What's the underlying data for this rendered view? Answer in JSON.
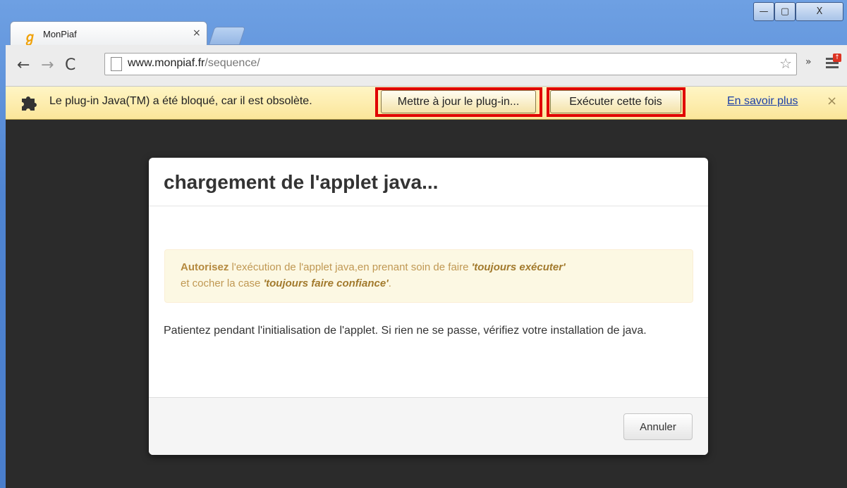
{
  "tab": {
    "title": "MonPiaf",
    "close": "×"
  },
  "window_controls": {
    "minimize": "—",
    "maximize": "▢",
    "close": "X"
  },
  "address": {
    "domain": "www.monpiaf.fr",
    "path": "/sequence/"
  },
  "infobar": {
    "message": "Le plug-in Java(TM) a été bloqué, car il est obsolète.",
    "update_button": "Mettre à jour le plug-in...",
    "run_button": "Exécuter cette fois",
    "learn_more": "En savoir plus",
    "close": "×"
  },
  "dialog": {
    "title": "chargement de l'applet java...",
    "alert": {
      "strong": "Autorisez",
      "text1": " l'exécution de l'applet java,en prenant soin de faire ",
      "em1": "'toujours exécuter'",
      "text2": "et cocher la case ",
      "em2": "'toujours faire confiance'",
      "text3": "."
    },
    "body": "Patientez pendant l'initialisation de l'applet. Si rien ne se passe, vérifiez votre installation de java.",
    "cancel_button": "Annuler"
  },
  "colors": {
    "highlight": "#e00000",
    "infobar": "#fbe69a",
    "link": "#1a3fa8",
    "alert_text": "#c09853"
  }
}
